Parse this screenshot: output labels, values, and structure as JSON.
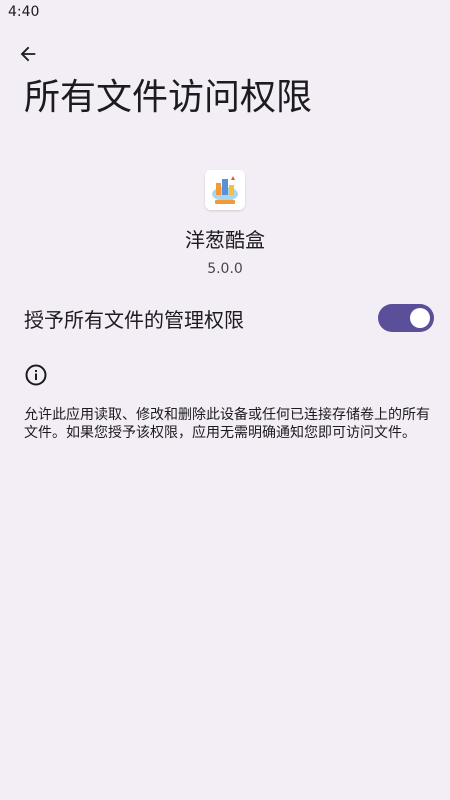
{
  "status_bar": {
    "time": "4:40"
  },
  "header": {
    "back_icon": "arrow-back-icon",
    "title": "所有文件访问权限"
  },
  "app": {
    "icon": "app-cloud-icon",
    "name": "洋葱酷盒",
    "version": "5.0.0"
  },
  "setting": {
    "label": "授予所有文件的管理权限",
    "toggle_on": true,
    "toggle_color": "#5b4f9a"
  },
  "info": {
    "icon": "info-icon",
    "description": "允许此应用读取、修改和删除此设备或任何已连接存储卷上的所有文件。如果您授予该权限，应用无需明确通知您即可访问文件。"
  },
  "colors": {
    "background": "#f3edf5",
    "accent": "#5b4f9a"
  }
}
